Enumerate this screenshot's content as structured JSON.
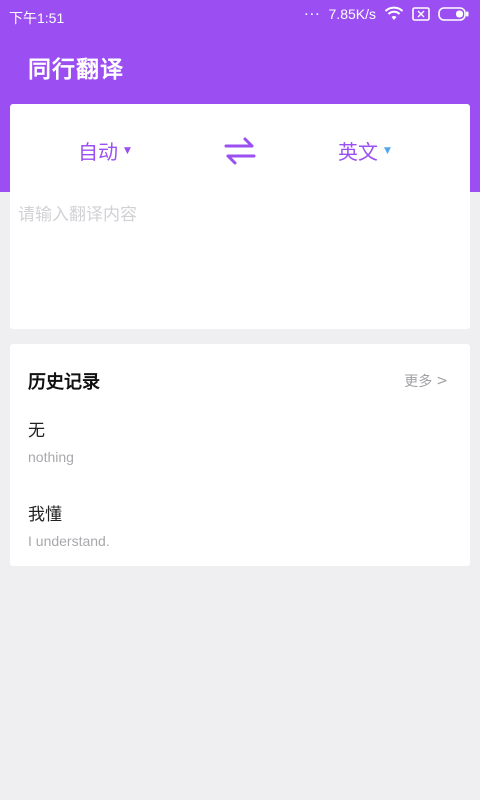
{
  "status_bar": {
    "time": "下午1:51",
    "dots": "...",
    "network_speed": "7.85K/s"
  },
  "header": {
    "title": "同行翻译"
  },
  "translator": {
    "source_language": "自动",
    "target_language": "英文",
    "input_placeholder": "请输入翻译内容",
    "input_value": ""
  },
  "history": {
    "title": "历史记录",
    "more_label": "更多",
    "more_arrow": ">",
    "items": [
      {
        "source": "无",
        "translation": "nothing"
      },
      {
        "source": "我懂",
        "translation": "I understand."
      }
    ]
  },
  "colors": {
    "brand": "#9b4ff2",
    "background": "#efeef1",
    "caret_accent": "#54a8ef"
  }
}
